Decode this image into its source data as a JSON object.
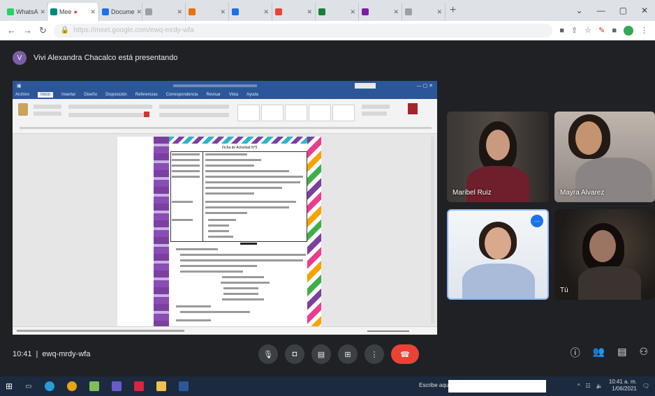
{
  "browser": {
    "tabs": [
      {
        "label": "WhatsA",
        "color": "#25d366"
      },
      {
        "label": "Mee",
        "color": "#00897b",
        "active": true
      },
      {
        "label": "Docume",
        "color": "#1a73e8"
      },
      {
        "label": "",
        "color": "#9aa0a6"
      },
      {
        "label": "",
        "color": "#e8710a"
      },
      {
        "label": "",
        "color": "#1a73e8"
      },
      {
        "label": "",
        "color": "#ea4335"
      },
      {
        "label": "",
        "color": "#188038"
      },
      {
        "label": "",
        "color": "#7b1fa2"
      },
      {
        "label": "",
        "color": "#9aa0a6"
      }
    ],
    "new_tab": "+",
    "url": "https://meet.google.com/ewq-mrdy-wfa"
  },
  "meet": {
    "presenter_initial": "V",
    "presenter_text": "Vivi Alexandra Chacalco está presentando",
    "participants": [
      {
        "name": "Maribel Ruiz"
      },
      {
        "name": "Mayra Alvarez"
      },
      {
        "name": ""
      },
      {
        "name": "Tú"
      }
    ],
    "time": "10:41",
    "separator": "|",
    "meeting_code": "ewq-mrdy-wfa"
  },
  "word": {
    "menu": [
      "Archivo",
      "Inicio",
      "Insertar",
      "Diseño",
      "Disposición",
      "Referencias",
      "Correspondencia",
      "Revisar",
      "Vista",
      "Ayuda"
    ],
    "doc_title": "Ficha de Actividad N°5"
  },
  "taskbar": {
    "search_label": "Escribe aquí",
    "clock_time": "10:41 a. m.",
    "clock_date": "1/06/2021"
  }
}
